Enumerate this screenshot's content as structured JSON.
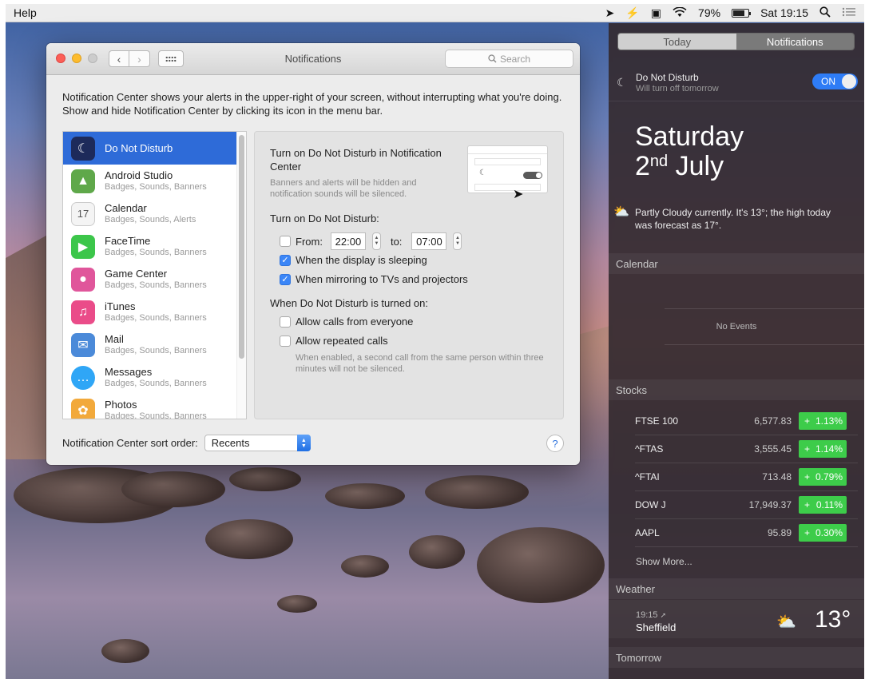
{
  "menubar": {
    "app_menu": "Help",
    "battery_percent": "79%",
    "battery_level": 0.79,
    "clock": "Sat 19:15",
    "icons": [
      "location-icon",
      "flash-icon",
      "sync-icon",
      "wifi-icon",
      "battery-icon",
      "spotlight-icon",
      "notification-center-icon"
    ]
  },
  "window": {
    "title": "Notifications",
    "search_placeholder": "Search",
    "intro": "Notification Center shows your alerts in the upper-right of your screen, without interrupting what you're doing. Show and hide Notification Center by clicking its icon in the menu bar.",
    "apps": [
      {
        "name": "Do Not Disturb",
        "sub": "",
        "icon": "moon-icon",
        "color": "#1d2a5a",
        "selected": true
      },
      {
        "name": "Android Studio",
        "sub": "Badges, Sounds, Banners",
        "icon": "android-studio-icon",
        "color": "#5fa84a"
      },
      {
        "name": "Calendar",
        "sub": "Badges, Sounds, Alerts",
        "icon": "calendar-icon",
        "color": "#f4f4f4"
      },
      {
        "name": "FaceTime",
        "sub": "Badges, Sounds, Banners",
        "icon": "facetime-icon",
        "color": "#3cc64a"
      },
      {
        "name": "Game Center",
        "sub": "Badges, Sounds, Banners",
        "icon": "game-center-icon",
        "color": "#e0569b"
      },
      {
        "name": "iTunes",
        "sub": "Badges, Sounds, Banners",
        "icon": "itunes-icon",
        "color": "#ea4c89"
      },
      {
        "name": "Mail",
        "sub": "Badges, Sounds, Banners",
        "icon": "mail-icon",
        "color": "#4b8ad9"
      },
      {
        "name": "Messages",
        "sub": "Badges, Sounds, Banners",
        "icon": "messages-icon",
        "color": "#2fa6f6"
      },
      {
        "name": "Photos",
        "sub": "Badges, Sounds, Banners",
        "icon": "photos-icon",
        "color": "#f2a93b"
      }
    ],
    "detail": {
      "title": "Turn on Do Not Disturb in Notification Center",
      "subtitle": "Banners and alerts will be hidden and notification sounds will be silenced.",
      "turn_on_label": "Turn on Do Not Disturb:",
      "from_label": "From:",
      "from_time": "22:00",
      "to_label": "to:",
      "to_time": "07:00",
      "display_sleeping": "When the display is sleeping",
      "mirroring": "When mirroring to TVs and projectors",
      "when_on_label": "When Do Not Disturb is turned on:",
      "allow_calls": "Allow calls from everyone",
      "allow_repeated": "Allow repeated calls",
      "note": "When enabled, a second call from the same person within three minutes will not be silenced."
    },
    "sort_label": "Notification Center sort order:",
    "sort_value": "Recents",
    "help_label": "?"
  },
  "nc": {
    "tab_today": "Today",
    "tab_notifications": "Notifications",
    "dnd_title": "Do Not Disturb",
    "dnd_sub": "Will turn off tomorrow",
    "dnd_switch": "ON",
    "date_day": "Saturday",
    "date_num": "2",
    "date_suffix": "nd",
    "date_month": " July",
    "weather_summary": "Partly Cloudy currently. It's 13°; the high today was forecast as 17°.",
    "calendar_header": "Calendar",
    "no_events": "No Events",
    "stocks_header": "Stocks",
    "stocks": [
      {
        "symbol": "FTSE 100",
        "price": "6,577.83",
        "sign": "+",
        "change": "1.13%"
      },
      {
        "symbol": "^FTAS",
        "price": "3,555.45",
        "sign": "+",
        "change": "1.14%"
      },
      {
        "symbol": "^FTAI",
        "price": "713.48",
        "sign": "+",
        "change": "0.79%"
      },
      {
        "symbol": "DOW J",
        "price": "17,949.37",
        "sign": "+",
        "change": "0.11%"
      },
      {
        "symbol": "AAPL",
        "price": "95.89",
        "sign": "+",
        "change": "0.30%"
      }
    ],
    "show_more": "Show More...",
    "weather_header": "Weather",
    "weather_time": "19:15",
    "weather_city": "Sheffield",
    "weather_temp": "13°",
    "tomorrow_header": "Tomorrow"
  }
}
